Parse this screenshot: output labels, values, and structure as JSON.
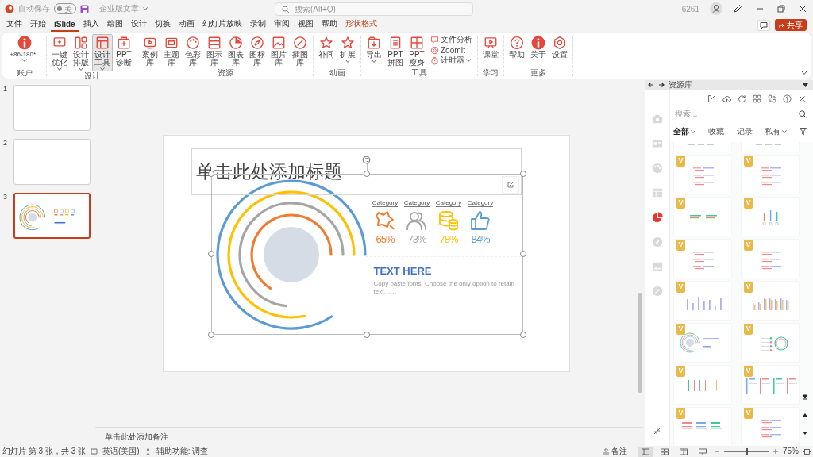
{
  "title_bar": {
    "autosave_label": "自动保存",
    "autosave_toggle": {
      "label": "关",
      "on": false
    },
    "document_name": "企业版文章",
    "search": {
      "placeholder": "搜索(Alt+Q)"
    },
    "user_id": "6261"
  },
  "menu_tabs": [
    {
      "label": "文件",
      "selected": false,
      "kind": "normal"
    },
    {
      "label": "开始",
      "selected": false,
      "kind": "normal"
    },
    {
      "label": "iSlide",
      "selected": true,
      "kind": "normal"
    },
    {
      "label": "插入",
      "selected": false,
      "kind": "normal"
    },
    {
      "label": "绘图",
      "selected": false,
      "kind": "normal"
    },
    {
      "label": "设计",
      "selected": false,
      "kind": "normal"
    },
    {
      "label": "切换",
      "selected": false,
      "kind": "normal"
    },
    {
      "label": "动画",
      "selected": false,
      "kind": "normal"
    },
    {
      "label": "幻灯片放映",
      "selected": false,
      "kind": "normal"
    },
    {
      "label": "录制",
      "selected": false,
      "kind": "normal"
    },
    {
      "label": "审阅",
      "selected": false,
      "kind": "normal"
    },
    {
      "label": "视图",
      "selected": false,
      "kind": "normal"
    },
    {
      "label": "帮助",
      "selected": false,
      "kind": "normal"
    },
    {
      "label": "形状格式",
      "selected": false,
      "kind": "contextual"
    }
  ],
  "share_button": "共享",
  "ribbon": {
    "groups": [
      {
        "label": "账户",
        "buttons": [
          {
            "label": "+86-180*..",
            "kind": "large",
            "has_menu": true,
            "pressed": false
          }
        ]
      },
      {
        "label": "设计",
        "buttons": [
          {
            "label": "一键优化",
            "kind": "large",
            "has_menu": true,
            "pressed": false
          },
          {
            "label": "设计排版",
            "kind": "large",
            "has_menu": true,
            "pressed": false
          },
          {
            "label": "设计工具",
            "kind": "large",
            "has_menu": true,
            "pressed": true
          },
          {
            "label": "PPT诊断",
            "kind": "large",
            "has_menu": false,
            "pressed": false
          }
        ]
      },
      {
        "label": "资源",
        "buttons": [
          {
            "label": "案例库",
            "kind": "large",
            "has_menu": false,
            "pressed": false
          },
          {
            "label": "主题库",
            "kind": "large",
            "has_menu": false,
            "pressed": false
          },
          {
            "label": "色彩库",
            "kind": "large",
            "has_menu": false,
            "pressed": false
          },
          {
            "label": "图示库",
            "kind": "large",
            "has_menu": false,
            "pressed": false
          },
          {
            "label": "图表库",
            "kind": "large",
            "has_menu": false,
            "pressed": false
          },
          {
            "label": "图标库",
            "kind": "large",
            "has_menu": false,
            "pressed": false
          },
          {
            "label": "图片库",
            "kind": "large",
            "has_menu": false,
            "pressed": false
          },
          {
            "label": "插图库",
            "kind": "large",
            "has_menu": false,
            "pressed": false
          }
        ]
      },
      {
        "label": "动画",
        "buttons": [
          {
            "label": "补间",
            "kind": "large",
            "has_menu": false,
            "pressed": false
          },
          {
            "label": "扩展",
            "kind": "large",
            "has_menu": true,
            "pressed": false
          }
        ]
      },
      {
        "label": "工具",
        "buttons": [
          {
            "label": "导出",
            "kind": "large",
            "has_menu": true,
            "pressed": false
          },
          {
            "label": "PPT拼图",
            "kind": "large",
            "has_menu": false,
            "pressed": false
          },
          {
            "label": "PPT瘦身",
            "kind": "large",
            "has_menu": false,
            "pressed": false
          },
          {
            "label": "文件分析",
            "kind": "small",
            "has_menu": false,
            "pressed": false
          },
          {
            "label": "ZoomIt",
            "kind": "small",
            "has_menu": false,
            "pressed": false
          },
          {
            "label": "计时器",
            "kind": "small",
            "has_menu": true,
            "pressed": false
          }
        ]
      },
      {
        "label": "学习",
        "buttons": [
          {
            "label": "课堂",
            "kind": "large",
            "has_menu": false,
            "pressed": false
          }
        ]
      },
      {
        "label": "更多",
        "buttons": [
          {
            "label": "帮助",
            "kind": "large",
            "has_menu": false,
            "pressed": false
          },
          {
            "label": "关于",
            "kind": "large",
            "has_menu": false,
            "pressed": false
          },
          {
            "label": "设置",
            "kind": "large",
            "has_menu": false,
            "pressed": false
          }
        ]
      }
    ]
  },
  "slides": [
    {
      "number": "1",
      "selected": false,
      "kind": "blank"
    },
    {
      "number": "2",
      "selected": false,
      "kind": "blank"
    },
    {
      "number": "3",
      "selected": true,
      "kind": "infographic"
    }
  ],
  "slide": {
    "title_placeholder": "单击此处添加标题",
    "categories": [
      {
        "label": "Category",
        "value": "65%",
        "color": "#ed7d31"
      },
      {
        "label": "Category",
        "value": "73%",
        "color": "#a5a5a5"
      },
      {
        "label": "Category",
        "value": "78%",
        "color": "#ffc000"
      },
      {
        "label": "Category",
        "value": "84%",
        "color": "#5b9bd5"
      }
    ],
    "heading": "TEXT HERE",
    "body": "Copy paste fonts. Choose the only option to retain text……"
  },
  "notes_placeholder": "单击此处添加备注",
  "resource_panel": {
    "title": "资源库",
    "search": {
      "placeholder": "搜索..."
    },
    "filters": [
      {
        "label": "全部",
        "selected": true,
        "has_menu": true
      },
      {
        "label": "收藏",
        "selected": false,
        "has_menu": false
      },
      {
        "label": "记录",
        "selected": false,
        "has_menu": false
      },
      {
        "label": "私有",
        "selected": false,
        "has_menu": true
      }
    ],
    "categories": [
      {
        "selected": false
      },
      {
        "selected": false
      },
      {
        "selected": false
      },
      {
        "selected": false
      },
      {
        "selected": true
      },
      {
        "selected": false
      },
      {
        "selected": false
      },
      {
        "selected": false
      }
    ],
    "templates": [
      {
        "kind": "partial"
      },
      {
        "kind": "partial"
      },
      {
        "kind": "bars",
        "badge": "V"
      },
      {
        "kind": "bars",
        "badge": "V"
      },
      {
        "kind": "lines",
        "badge": "V"
      },
      {
        "kind": "thermo",
        "badge": "V"
      },
      {
        "kind": "bars",
        "badge": "V"
      },
      {
        "kind": "bars",
        "badge": "V"
      },
      {
        "kind": "columns",
        "badge": "V"
      },
      {
        "kind": "columns2",
        "badge": "V"
      },
      {
        "kind": "rings",
        "badge": "V"
      },
      {
        "kind": "donut",
        "badge": "V"
      },
      {
        "kind": "pins",
        "badge": "V"
      },
      {
        "kind": "panels",
        "badge": "V"
      },
      {
        "kind": "stats",
        "badge": "V"
      },
      {
        "kind": "bars",
        "badge": "V"
      }
    ]
  },
  "status_bar": {
    "slide_info": "幻灯片 第 3 张，共 3 张",
    "language": "英语(美国)",
    "accessibility": "辅助功能: 调查",
    "notes_button": "备注",
    "views": [
      {
        "selected": true
      },
      {
        "selected": false
      },
      {
        "selected": false
      },
      {
        "selected": false
      }
    ],
    "zoom": {
      "level": 0.5,
      "reading": "75%"
    }
  }
}
